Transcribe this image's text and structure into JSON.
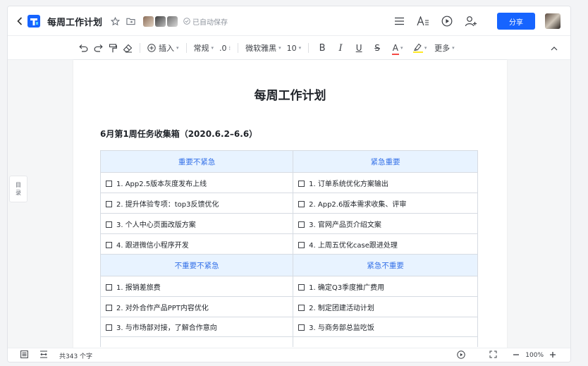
{
  "header": {
    "back_icon": "chevron-left-icon",
    "doc_title": "每周工作计划",
    "save_status": "已自动保存",
    "share_label": "分享"
  },
  "toolbar": {
    "insert_label": "插入",
    "paragraph_style": "常规",
    "line_spacing": ".0",
    "font_name": "微软雅黑",
    "font_size": "10",
    "bold_glyph": "B",
    "italic_glyph": "I",
    "underline_glyph": "U",
    "strike_glyph": "S",
    "font_color_glyph": "A",
    "more_label": "更多"
  },
  "outline": {
    "label_top": "目",
    "label_bottom": "录"
  },
  "document": {
    "title": "每周工作计划",
    "section_heading": "6月第1周任务收集箱（2020.6.2–6.6）",
    "quadrants": {
      "important_not_urgent": {
        "title": "重要不紧急",
        "items": [
          "1. App2.5版本灰度发布上线",
          "2. 提升体验专项：top3反馈优化",
          "3. 个人中心页面改版方案",
          "4. 跟进微信小程序开发"
        ]
      },
      "urgent_important": {
        "title": "紧急重要",
        "items": [
          "1. 订单系统优化方案输出",
          "2. App2.6版本需求收集、评审",
          "3. 官网产品页介绍文案",
          "4. 上周五优化case跟进处理"
        ]
      },
      "not_important_not_urgent": {
        "title": "不重要不紧急",
        "items": [
          "1. 报销差旅费",
          "2. 对外合作产品PPT内容优化",
          "3. 与市场部对接，了解合作意向"
        ]
      },
      "urgent_not_important": {
        "title": "紧急不重要",
        "items": [
          "1. 确定Q3季度推广费用",
          "2. 制定团建活动计划",
          "3. 与商务部总监吃饭"
        ]
      }
    }
  },
  "statusbar": {
    "word_count": "共343 个字",
    "zoom": "100%"
  },
  "colors": {
    "accent": "#1664ff",
    "header_cell_bg": "#e8f3ff",
    "header_cell_text": "#3370e8"
  }
}
